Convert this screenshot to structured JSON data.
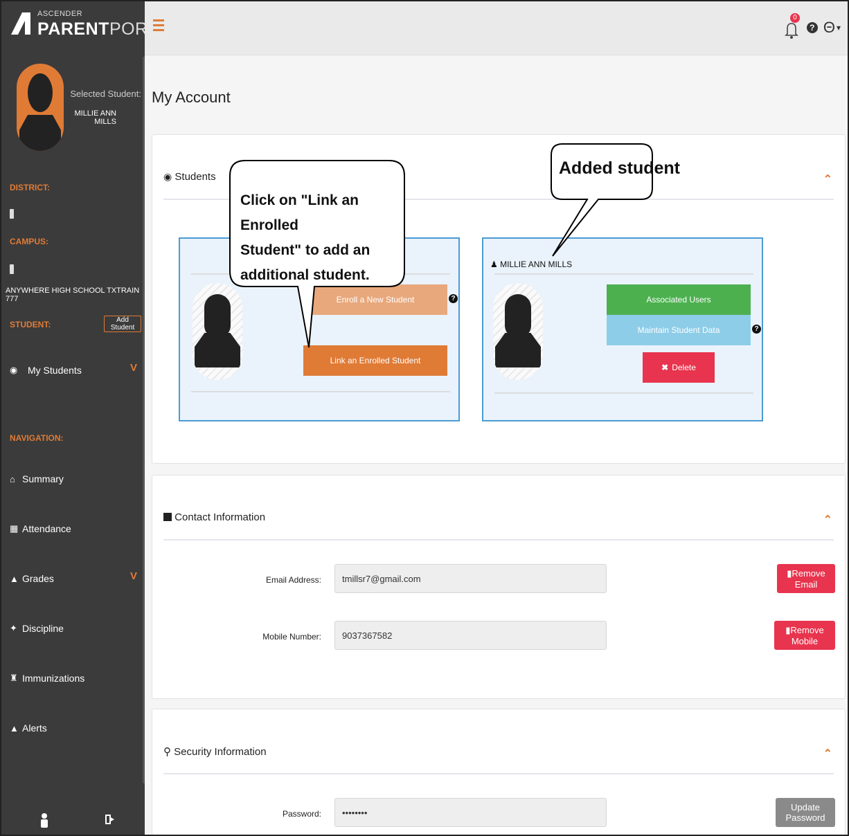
{
  "app": {
    "logo_small": "ASCENDER",
    "logo_bold": "PARENT",
    "logo_light": "PORTAL",
    "brand_color": "#e07b36"
  },
  "sidebar": {
    "selected_label": "Selected Student:",
    "selected_name": "MILLIE ANN MILLS",
    "district_heading": "DISTRICT:",
    "campus_heading": "CAMPUS:",
    "campus_name": "ANYWHERE HIGH SCHOOL TXTRAIN 777",
    "student_heading": "STUDENT:",
    "add_student": "Add Student",
    "my_students": "My Students",
    "navigation_heading": "NAVIGATION:",
    "nav": [
      {
        "label": "Summary",
        "icon": "home-icon"
      },
      {
        "label": "Attendance",
        "icon": "calendar-icon"
      },
      {
        "label": "Grades",
        "icon": "graduation-cap-icon"
      },
      {
        "label": "Discipline",
        "icon": "gavel-icon"
      },
      {
        "label": "Immunizations",
        "icon": "syringe-icon"
      },
      {
        "label": "Alerts",
        "icon": "bell-icon"
      }
    ]
  },
  "topbar": {
    "notification_count": "0"
  },
  "page": {
    "title": "My Account"
  },
  "students_panel": {
    "title": "Students",
    "enroll_button": "Enroll a New Student",
    "link_button": "Link an Enrolled Student",
    "student_name": "MILLIE ANN MILLS",
    "associated_users": "Associated Users",
    "maintain_data": "Maintain Student Data",
    "delete": "Delete"
  },
  "contact_panel": {
    "title": "Contact Information",
    "email_label": "Email Address:",
    "email_value": "tmillsr7@gmail.com",
    "mobile_label": "Mobile Number:",
    "mobile_value": "9037367582",
    "remove_email": "Remove Email",
    "remove_mobile": "Remove Mobile"
  },
  "security_panel": {
    "title": "Security Information",
    "password_label": "Password:",
    "password_value": "••••••••",
    "update_password": "Update Password"
  },
  "callouts": {
    "link_instruction_line1": "Click on \"Link an Enrolled",
    "link_instruction_line2": "Student\" to add an",
    "link_instruction_line3": "additional student.",
    "added_student": "Added student"
  }
}
